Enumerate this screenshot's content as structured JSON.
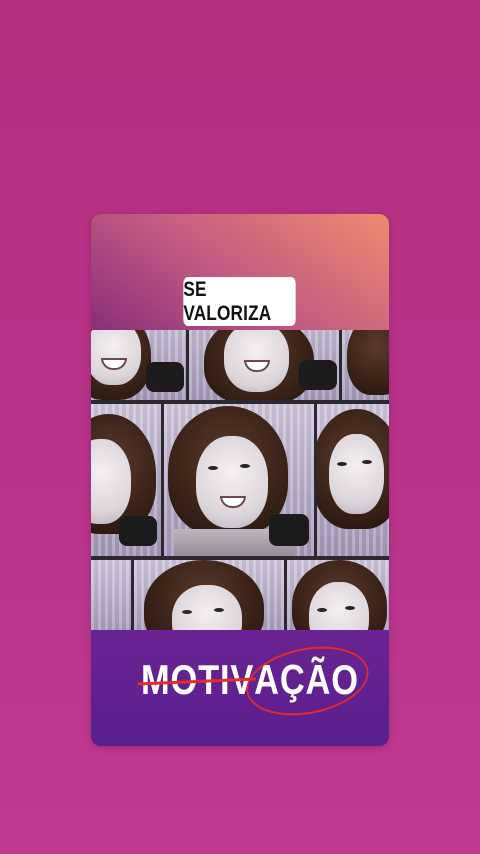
{
  "story": {
    "title_sticker": "SE VALORIZA",
    "brand": {
      "struck_text": "MOTIV",
      "circled_text": "AÇÃO"
    }
  },
  "colors": {
    "background": "#b8328a",
    "card_bottom": "#5d2190",
    "header_gradient_start": "#8a2f78",
    "header_gradient_end": "#ee8b6f",
    "accent_red": "#e62b2b"
  }
}
